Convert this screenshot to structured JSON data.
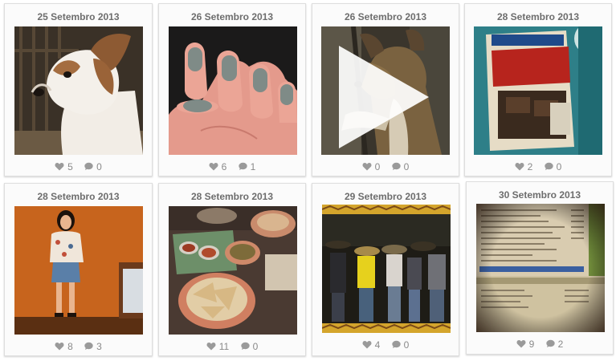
{
  "colors": {
    "icon": "#9a9a9a",
    "date_text": "#6d6d6d",
    "card_border": "#dedede"
  },
  "icons": {
    "likes": "heart-icon",
    "comments": "comment-bubble-icon",
    "video": "play-icon"
  },
  "posts": [
    {
      "date": "25 Setembro 2013",
      "likes": "5",
      "comments": "0",
      "subject": "dog portrait"
    },
    {
      "date": "26 Setembro 2013",
      "likes": "6",
      "comments": "1",
      "subject": "grey nail polish"
    },
    {
      "date": "26 Setembro 2013",
      "likes": "0",
      "comments": "0",
      "subject": "dog video",
      "is_video": true
    },
    {
      "date": "28 Setembro 2013",
      "likes": "2",
      "comments": "0",
      "subject": "chocolate package"
    },
    {
      "date": "28 Setembro 2013",
      "likes": "8",
      "comments": "3",
      "subject": "woman on orange wall"
    },
    {
      "date": "28 Setembro 2013",
      "likes": "11",
      "comments": "0",
      "subject": "nachos and dips"
    },
    {
      "date": "29 Setembro 2013",
      "likes": "4",
      "comments": "0",
      "subject": "group with sombreros"
    },
    {
      "date": "30 Setembro 2013",
      "likes": "9",
      "comments": "2",
      "subject": "computer screen downloads"
    }
  ]
}
